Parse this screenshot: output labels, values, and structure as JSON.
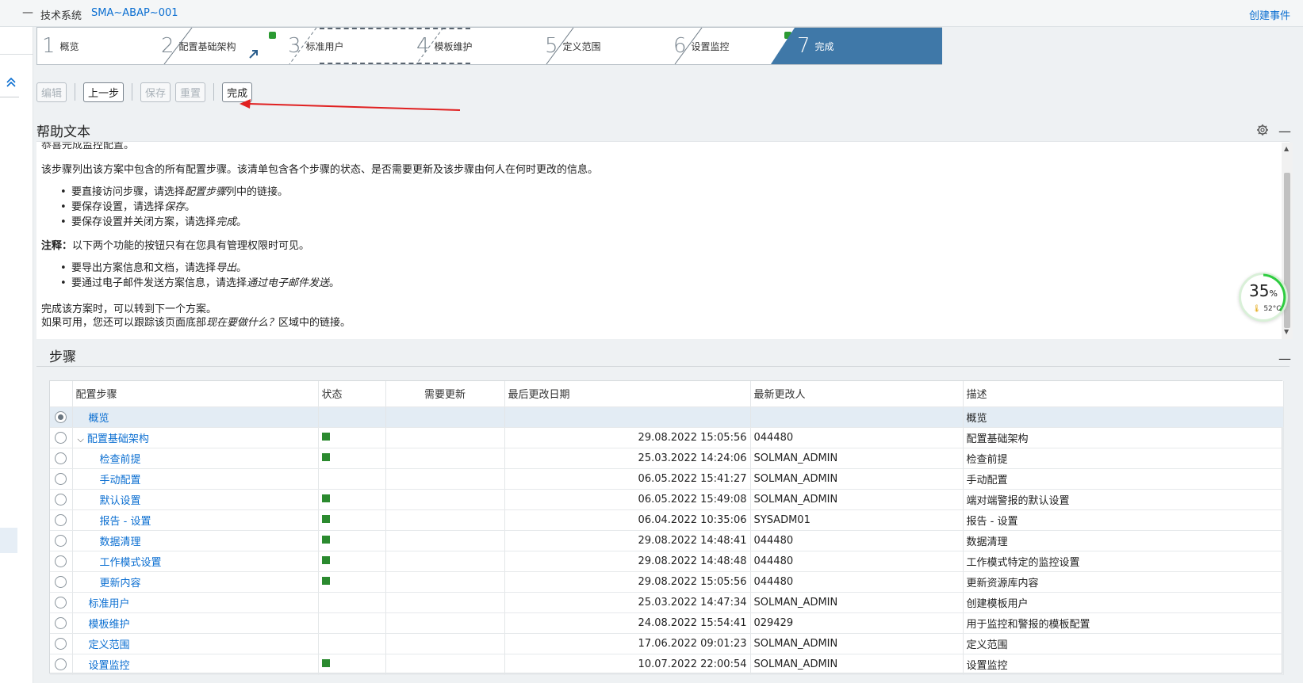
{
  "topbar": {
    "label": "技术系统",
    "system": "SMA~ABAP~001",
    "create_event": "创建事件"
  },
  "wizard": {
    "steps": [
      {
        "num": "1",
        "label": "概览"
      },
      {
        "num": "2",
        "label": "配置基础架构"
      },
      {
        "num": "3",
        "label": "标准用户"
      },
      {
        "num": "4",
        "label": "模板维护"
      },
      {
        "num": "5",
        "label": "定义范围"
      },
      {
        "num": "6",
        "label": "设置监控"
      },
      {
        "num": "7",
        "label": "完成"
      }
    ]
  },
  "toolbar": {
    "edit": "编辑",
    "prev": "上一步",
    "save": "保存",
    "reset": "重置",
    "finish": "完成"
  },
  "help": {
    "title": "帮助文本",
    "cut_line": "恭喜完成监控配置。",
    "intro": "该步骤列出该方案中包含的所有配置步骤。该清单包含各个步骤的状态、是否需要更新及该步骤由何人在何时更改的信息。",
    "b1_pre": "要直接访问步骤，请选择",
    "b1_em": "配置步骤",
    "b1_post": "列中的链接。",
    "b2_pre": "要保存设置，请选择",
    "b2_em": "保存",
    "b2_post": "。",
    "b3_pre": "要保存设置并关闭方案，请选择",
    "b3_em": "完成",
    "b3_post": "。",
    "note_label": "注释：",
    "note_text": "以下两个功能的按钮只有在您具有管理权限时可见。",
    "b4_pre": "要导出方案信息和文档，请选择",
    "b4_em": "导出",
    "b4_post": "。",
    "b5_pre": "要通过电子邮件发送方案信息，请选择",
    "b5_em": "通过电子邮件发送",
    "b5_post": "。",
    "end1": "完成该方案时，可以转到下一个方案。",
    "end2_pre": "如果可用，您还可以跟踪该页面底部",
    "end2_em": "现在要做什么？",
    "end2_post": "区域中的链接。"
  },
  "gauge": {
    "percent": "35",
    "unit": "%",
    "temp": "52°C"
  },
  "steps": {
    "title": "步骤",
    "columns": [
      "配置步骤",
      "状态",
      "需要更新",
      "最后更改日期",
      "最新更改人",
      "描述"
    ],
    "rows": [
      {
        "name": "概览",
        "status": false,
        "date": "",
        "user": "",
        "desc": "概览",
        "level": 0,
        "selected": true,
        "expand": false
      },
      {
        "name": "配置基础架构",
        "status": true,
        "date": "29.08.2022 15:05:56",
        "user": "044480",
        "desc": "配置基础架构",
        "level": 0,
        "selected": false,
        "expand": true
      },
      {
        "name": "检查前提",
        "status": true,
        "date": "25.03.2022 14:24:06",
        "user": "SOLMAN_ADMIN",
        "desc": "检查前提",
        "level": 1,
        "selected": false,
        "expand": false
      },
      {
        "name": "手动配置",
        "status": false,
        "date": "06.05.2022 15:41:27",
        "user": "SOLMAN_ADMIN",
        "desc": "手动配置",
        "level": 1,
        "selected": false,
        "expand": false
      },
      {
        "name": "默认设置",
        "status": true,
        "date": "06.05.2022 15:49:08",
        "user": "SOLMAN_ADMIN",
        "desc": "端对端警报的默认设置",
        "level": 1,
        "selected": false,
        "expand": false
      },
      {
        "name": "报告 - 设置",
        "status": true,
        "date": "06.04.2022 10:35:06",
        "user": "SYSADM01",
        "desc": "报告 - 设置",
        "level": 1,
        "selected": false,
        "expand": false
      },
      {
        "name": "数据清理",
        "status": true,
        "date": "29.08.2022 14:48:41",
        "user": "044480",
        "desc": "数据清理",
        "level": 1,
        "selected": false,
        "expand": false
      },
      {
        "name": "工作模式设置",
        "status": true,
        "date": "29.08.2022 14:48:48",
        "user": "044480",
        "desc": "工作模式特定的监控设置",
        "level": 1,
        "selected": false,
        "expand": false
      },
      {
        "name": "更新内容",
        "status": true,
        "date": "29.08.2022 15:05:56",
        "user": "044480",
        "desc": "更新资源库内容",
        "level": 1,
        "selected": false,
        "expand": false
      },
      {
        "name": "标准用户",
        "status": false,
        "date": "25.03.2022 14:47:34",
        "user": "SOLMAN_ADMIN",
        "desc": "创建模板用户",
        "level": 0,
        "selected": false,
        "expand": false
      },
      {
        "name": "模板维护",
        "status": false,
        "date": "24.08.2022 15:54:41",
        "user": "029429",
        "desc": "用于监控和警报的模板配置",
        "level": 0,
        "selected": false,
        "expand": false
      },
      {
        "name": "定义范围",
        "status": false,
        "date": "17.06.2022 09:01:23",
        "user": "SOLMAN_ADMIN",
        "desc": "定义范围",
        "level": 0,
        "selected": false,
        "expand": false
      },
      {
        "name": "设置监控",
        "status": true,
        "date": "10.07.2022 22:00:54",
        "user": "SOLMAN_ADMIN",
        "desc": "设置监控",
        "level": 0,
        "selected": false,
        "expand": false
      }
    ]
  },
  "colors": {
    "accent": "#0a6ed1",
    "done_step": "#3f78a8",
    "status_green": "#2b8a2f",
    "arrow": "#e02020"
  }
}
